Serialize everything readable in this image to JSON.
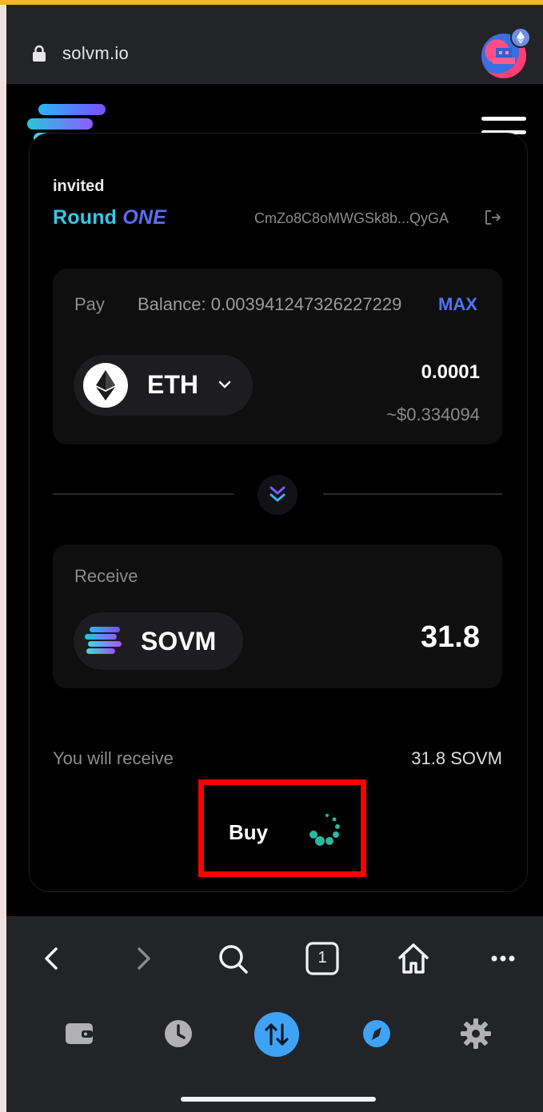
{
  "browser": {
    "url": "solvm.io",
    "tab_count": "1"
  },
  "card": {
    "invited_label": "invited",
    "round_prefix": "Round",
    "round_suffix": "ONE",
    "wallet_address": "CmZo8C8oMWGSk8b...QyGA"
  },
  "pay": {
    "label": "Pay",
    "balance": "Balance: 0.003941247326227229",
    "max_label": "MAX",
    "token": "ETH",
    "amount": "0.0001",
    "usd_value": "~$0.334094"
  },
  "receive": {
    "label": "Receive",
    "token": "SOVM",
    "amount": "31.8"
  },
  "summary": {
    "you_will_receive_label": "You will receive",
    "you_will_receive_value": "31.8 SOVM"
  },
  "buy_button": {
    "label": "Buy",
    "loading": true
  },
  "colors": {
    "accent_blue": "#4e74f5",
    "round_cyan": "#37c6e8",
    "spinner_teal": "#2ab8a0",
    "highlight_red": "#ff0000",
    "swap_active": "#3fa3f5"
  },
  "icons": {
    "lock": "lock-icon",
    "menu": "hamburger-menu-icon",
    "logout": "logout-icon",
    "swap": "double-chevron-down-icon",
    "nav": [
      "back-icon",
      "forward-icon",
      "search-icon",
      "tabs-icon",
      "home-icon",
      "more-icon"
    ],
    "toolbar": [
      "wallet-icon",
      "history-icon",
      "swap-icon",
      "discover-icon",
      "settings-icon"
    ]
  }
}
